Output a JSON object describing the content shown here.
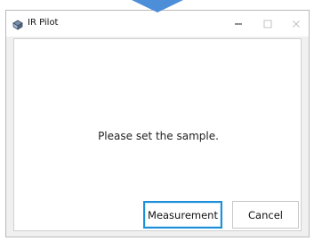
{
  "window": {
    "title": "IR Pilot"
  },
  "dialog": {
    "message": "Please set the sample.",
    "buttons": {
      "measurement": "Measurement",
      "cancel": "Cancel"
    }
  },
  "colors": {
    "focus_border": "#1f8fd8",
    "indicator_arrow": "#4c8ed8"
  },
  "icons": {
    "app": "app-icon",
    "minimize": "minimize-icon",
    "maximize": "maximize-icon",
    "close": "close-icon"
  }
}
